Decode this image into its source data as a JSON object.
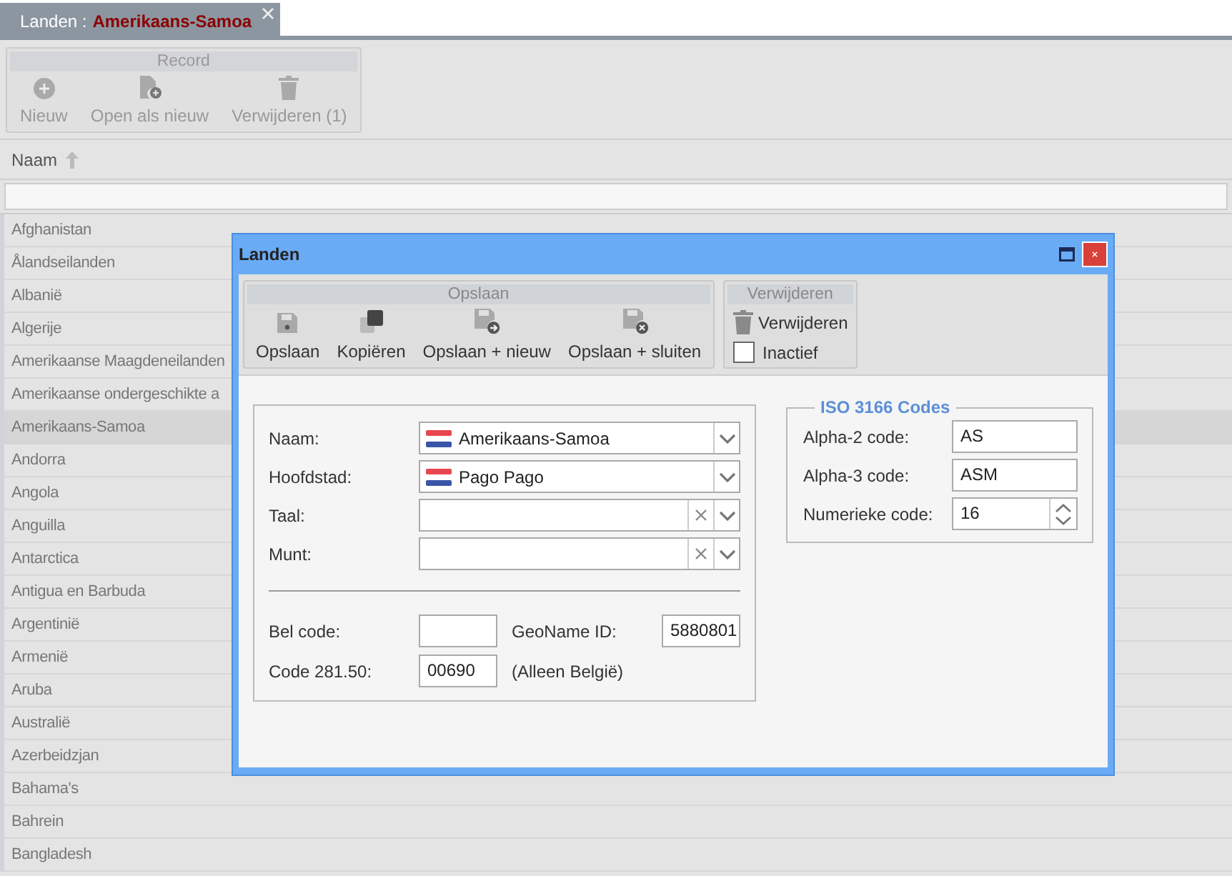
{
  "tab": {
    "prefix": "Landen :",
    "record": "Amerikaans-Samoa"
  },
  "record_toolbar": {
    "title": "Record",
    "buttons": [
      {
        "label": "Nieuw",
        "kind": "add",
        "disabled": true
      },
      {
        "label": "Open als nieuw",
        "kind": "open-new",
        "disabled": true
      },
      {
        "label": "Verwijderen (1)",
        "kind": "delete",
        "disabled": true
      }
    ]
  },
  "grid": {
    "column": "Naam",
    "rows": [
      {
        "name": "Afghanistan",
        "selected": false
      },
      {
        "name": "Ålandseilanden",
        "selected": false
      },
      {
        "name": "Albanië",
        "selected": false
      },
      {
        "name": "Algerije",
        "selected": false
      },
      {
        "name": "Amerikaanse Maagdeneilanden",
        "selected": false
      },
      {
        "name": "Amerikaanse ondergeschikte a",
        "selected": false
      },
      {
        "name": "Amerikaans-Samoa",
        "selected": true
      },
      {
        "name": "Andorra",
        "selected": false
      },
      {
        "name": "Angola",
        "selected": false
      },
      {
        "name": "Anguilla",
        "selected": false
      },
      {
        "name": "Antarctica",
        "selected": false
      },
      {
        "name": "Antigua en Barbuda",
        "selected": false
      },
      {
        "name": "Argentinië",
        "selected": false
      },
      {
        "name": "Armenië",
        "selected": false
      },
      {
        "name": "Aruba",
        "selected": false
      },
      {
        "name": "Australië",
        "selected": false
      },
      {
        "name": "Azerbeidzjan",
        "selected": false
      },
      {
        "name": "Bahama's",
        "selected": false
      },
      {
        "name": "Bahrein",
        "selected": false
      },
      {
        "name": "Bangladesh",
        "selected": false
      }
    ]
  },
  "dialog": {
    "title": "Landen",
    "save_group": {
      "title": "Opslaan",
      "buttons": [
        {
          "label": "Opslaan",
          "kind": "save"
        },
        {
          "label": "Kopiëren",
          "kind": "copy"
        },
        {
          "label": "Opslaan + nieuw",
          "kind": "save-new"
        },
        {
          "label": "Opslaan + sluiten",
          "kind": "save-close"
        }
      ]
    },
    "delete_group": {
      "title": "Verwijderen",
      "button": {
        "label": "Verwijderen",
        "kind": "delete"
      },
      "inactive": {
        "label": "Inactief",
        "checked": false
      }
    },
    "fields": [
      {
        "label": "Naam:",
        "value": "Amerikaans-Samoa",
        "flag": true,
        "clearable": false
      },
      {
        "label": "Hoofdstad:",
        "value": "Pago Pago",
        "flag": true,
        "clearable": false
      },
      {
        "label": "Taal:",
        "flag": false,
        "clearable": true
      },
      {
        "label": "Munt:",
        "flag": false,
        "clearable": true
      }
    ],
    "bel_code": {
      "label": "Bel code:"
    },
    "geoname": {
      "label": "GeoName ID:",
      "value": "5880801"
    },
    "code_28150": {
      "label": "Code 281.50:",
      "value": "00690"
    },
    "belgium_note": "(Alleen België)",
    "iso": {
      "title": "ISO 3166 Codes",
      "fields": [
        {
          "label": "Alpha-2 code:",
          "value": "AS",
          "kind": "text"
        },
        {
          "label": "Alpha-3 code:",
          "value": "ASM",
          "kind": "text"
        },
        {
          "label": "Numerieke code:",
          "value": "16",
          "kind": "spinner"
        }
      ]
    }
  }
}
